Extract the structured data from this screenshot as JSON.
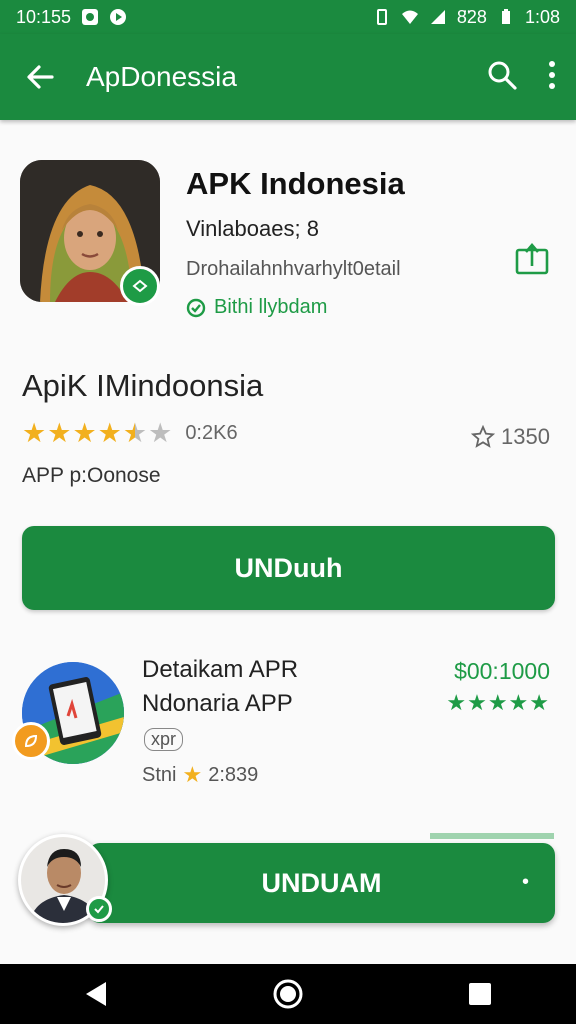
{
  "status_bar": {
    "time": "10:155",
    "right_text": "8̈28",
    "battery_text": "1:08"
  },
  "app_bar": {
    "title": "ApDonessia",
    "icons": [
      "back-arrow-icon",
      "search-icon",
      "more-vert-icon"
    ]
  },
  "app_header": {
    "name": "APK Indonesia",
    "subtitle": "Vinlaboaes; 8",
    "detail": "Drohailahnhvarhylt0etail",
    "verified_label": "Bithi llybdam",
    "share_icon": "share-icon"
  },
  "info": {
    "title": "ApiK IMindoonsia",
    "rating": 3.5,
    "rating_text": "0:2K6",
    "review_count": "1350",
    "meta": "APP p:Oonose"
  },
  "install_button": {
    "label": "UNDuuh"
  },
  "related_app": {
    "title_line1": "Detaikam APR",
    "title_line2": "Ndonaria APP",
    "tag": "xpr",
    "rating_prefix": "Stni",
    "rating_value": "2:839",
    "price": "$00:1000",
    "stars": 5
  },
  "floating_bar": {
    "label": "UNDUAM",
    "more_symbol": "•"
  },
  "colors": {
    "primary": "#1b8a3f",
    "accent_green": "#1e9b46",
    "star": "#f2b01e"
  }
}
